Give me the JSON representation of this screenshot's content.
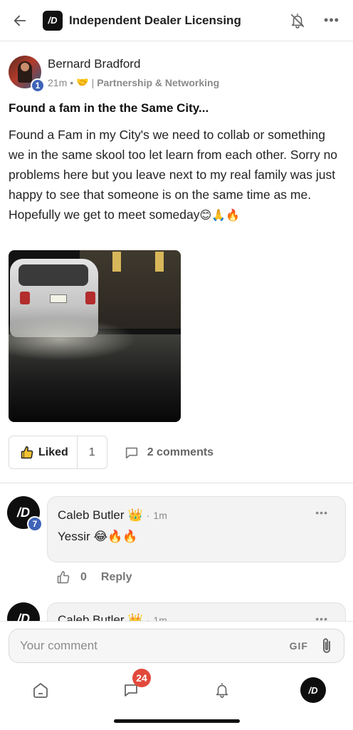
{
  "header": {
    "back_icon": "arrow-left-icon",
    "group_logo_text": "/D",
    "title": "Independent Dealer Licensing",
    "notification_icon": "bell-off-icon",
    "more_icon": "more-horizontal-icon",
    "more_glyph": "•••"
  },
  "post": {
    "author": "Bernard Bradford",
    "level": "1",
    "time": "21m",
    "dot": "•",
    "handshake": "🤝",
    "separator": "|",
    "category": "Partnership & Networking",
    "title": "Found a fam in the the Same City...",
    "body": "Found a Fam in my City's we need to collab or something we in the same skool too let learn from each other. Sorry no problems here but you leave next to my real family was just happy to see that someone is on the same time as me. Hopefully we get to meet someday",
    "body_emojis": "😊🙏🔥",
    "image_icon": "post-photo"
  },
  "actions": {
    "like_label": "Liked",
    "like_count": "1",
    "comments_label": "2 comments",
    "like_icon": "thumbs-up-icon",
    "comment_icon": "comment-icon"
  },
  "comments": [
    {
      "author": "Caleb Butler",
      "badge": "👑",
      "dot": "·",
      "time": "1m",
      "level": "7",
      "avatar_text": "/D",
      "text": "Yessir 😂🔥🔥",
      "likes": "0",
      "reply_label": "Reply",
      "more_glyph": "•••"
    },
    {
      "author": "Caleb Butler",
      "badge": "👑",
      "dot": "·",
      "time": "1m",
      "avatar_text": "/D",
      "more_glyph": "•••"
    }
  ],
  "composer": {
    "placeholder": "Your comment",
    "gif_label": "GIF",
    "attach_icon": "paperclip-icon"
  },
  "tabbar": {
    "home_icon": "home-icon",
    "chat_icon": "chat-icon",
    "chat_badge": "24",
    "notifications_icon": "bell-icon",
    "profile_text": "/D"
  }
}
